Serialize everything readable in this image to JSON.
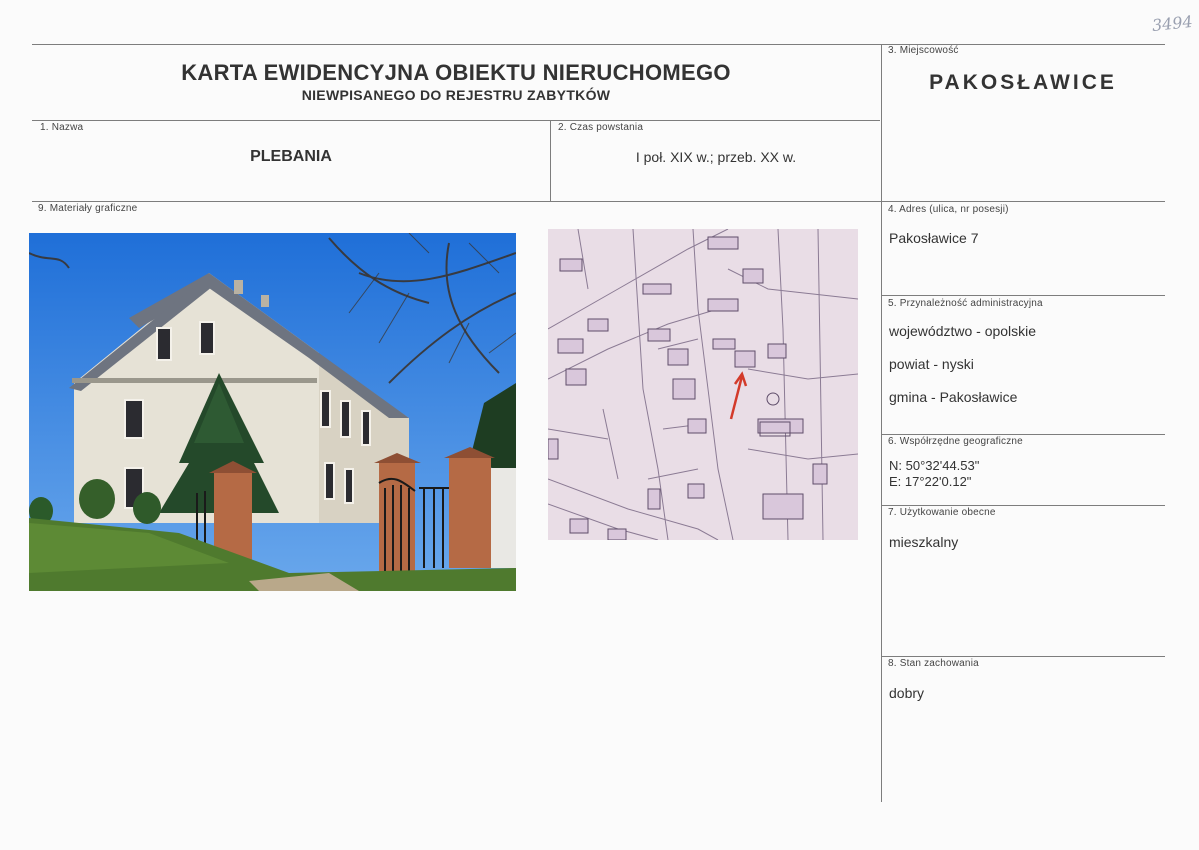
{
  "card": {
    "title": "KARTA EWIDENCYJNA OBIEKTU NIERUCHOMEGO",
    "subtitle": "NIEWPISANEGO DO REJESTRU ZABYTKÓW",
    "handwritten_note": "3494"
  },
  "fields": {
    "name": {
      "label": "1. Nazwa",
      "value": "PLEBANIA"
    },
    "period": {
      "label": "2. Czas powstania",
      "value": "I poł. XIX w.; przeb. XX w."
    },
    "locality": {
      "label": "3. Miejscowość",
      "value": "PAKOSŁAWICE"
    },
    "address": {
      "label": "4. Adres (ulica, nr posesji)",
      "value": "Pakosławice 7"
    },
    "admin": {
      "label": "5. Przynależność administracyjna",
      "voivodeship": "województwo - opolskie",
      "county": "powiat - nyski",
      "commune": "gmina - Pakosławice"
    },
    "coords": {
      "label": "6. Współrzędne geograficzne",
      "n": "N: 50°32'44.53\"",
      "e": "E: 17°22'0.12\""
    },
    "usage": {
      "label": "7. Użytkowanie obecne",
      "value": "mieszkalny"
    },
    "condition": {
      "label": "8. Stan zachowania",
      "value": "dobry"
    },
    "graphics": {
      "label": "9. Materiały graficzne"
    }
  },
  "colors": {
    "sky": "#2f7de0",
    "wall": "#e6e2d6",
    "roof": "#6e7480",
    "brick": "#b56a45",
    "grass": "#4f7a2e",
    "arrow": "#d33a2a"
  }
}
